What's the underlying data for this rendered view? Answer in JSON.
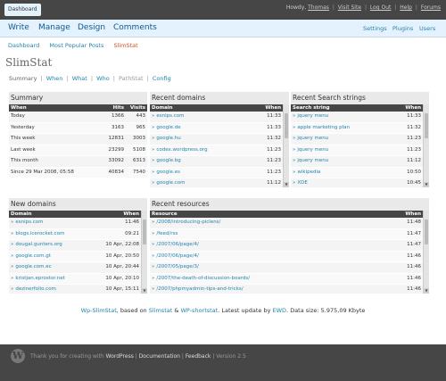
{
  "topbar": {
    "dashboard_label": "Dashboard",
    "howdy": "Howdy,",
    "user": "Thomas",
    "links": [
      "Visit Site",
      "Log Out",
      "Help",
      "Forums"
    ]
  },
  "menu": {
    "main": [
      "Write",
      "Manage",
      "Design",
      "Comments"
    ],
    "right": [
      "Settings",
      "Plugins",
      "Users"
    ]
  },
  "submenu": [
    "Dashboard",
    "Most Popular Posts",
    "SlimStat"
  ],
  "page_title": "SlimStat",
  "tabs": [
    "Summary",
    "When",
    "What",
    "Who",
    "PathStat",
    "Config"
  ],
  "summary": {
    "title": "Summary",
    "headers": [
      "When",
      "Hits",
      "Visits"
    ],
    "rows": [
      [
        "Today",
        "1366",
        "443"
      ],
      [
        "Yesterday",
        "3163",
        "965"
      ],
      [
        "This week",
        "12831",
        "3003"
      ],
      [
        "Last week",
        "23299",
        "5108"
      ],
      [
        "This month",
        "33092",
        "6313"
      ],
      [
        "Since 29 Mar 2008, 05:58",
        "40834",
        "7540"
      ]
    ]
  },
  "recent_domains": {
    "title": "Recent domains",
    "headers": [
      "Domain",
      "When"
    ],
    "rows": [
      [
        "esnips.com",
        "11:33"
      ],
      [
        "google.de",
        "11:33"
      ],
      [
        "google.hu",
        "11:32"
      ],
      [
        "codex.wordpress.org",
        "11:23"
      ],
      [
        "google.bg",
        "11:23"
      ],
      [
        "google.es",
        "11:23"
      ],
      [
        "google.com",
        "11:12"
      ]
    ]
  },
  "recent_search": {
    "title": "Recent Search strings",
    "headers": [
      "Search string",
      "When"
    ],
    "rows": [
      [
        "jquery menu",
        "11:33"
      ],
      [
        "apple marketing plan",
        "11:32"
      ],
      [
        "jquery menu",
        "11:23"
      ],
      [
        "jquery menu",
        "11:23"
      ],
      [
        "jquery menu",
        "11:12"
      ],
      [
        "wikipedia",
        "10:50"
      ],
      [
        "XDE",
        "10:45"
      ]
    ]
  },
  "new_domains": {
    "title": "New domains",
    "headers": [
      "Domain",
      "When"
    ],
    "rows": [
      [
        "esnips.com",
        "11:46"
      ],
      [
        "blogs.icerocket.com",
        "09:21"
      ],
      [
        "dougal.gunters.org",
        "10 Apr, 22:08"
      ],
      [
        "google.com.gt",
        "10 Apr, 20:50"
      ],
      [
        "google.com.ec",
        "10 Apr, 20:44"
      ],
      [
        "kristjan.eprostor.net",
        "10 Apr, 20:10"
      ],
      [
        "dezinerfolio.com",
        "10 Apr, 15:11"
      ]
    ]
  },
  "recent_resources": {
    "title": "Recent resources",
    "headers": [
      "Resource",
      "When"
    ],
    "rows": [
      [
        "/2008/introducing-piclens/",
        "11:48"
      ],
      [
        "/feed/rss",
        "11:47"
      ],
      [
        "/2007/06/page/4/",
        "11:47"
      ],
      [
        "/2007/06/page/4/",
        "11:46"
      ],
      [
        "/2007/05/page/3/",
        "11:46"
      ],
      [
        "/2007/the-death-of-discussion-boards/",
        "11:46"
      ],
      [
        "/2007/phpmyadmin-tips-and-tricks/",
        "11:46"
      ]
    ]
  },
  "footline": {
    "p1": "Wp-SlimStat",
    "p2": ", based on ",
    "p3": "Slimstat",
    "p4": " & ",
    "p5": "WP-shortstat",
    "p6": ". Latest update by ",
    "p7": "EWD",
    "p8": ". Data size: 5.975,09 Kbyte"
  },
  "footer": {
    "logo_letter": "W",
    "thanks": "Thank you for creating with ",
    "wordpress": "WordPress",
    "documentation": "Documentation",
    "feedback": "Feedback",
    "version": "Version 2.5"
  },
  "colors": {
    "topbar": "#464646",
    "menubar": "#e4f2fd",
    "link": "#2583ad",
    "current": "#d54e21",
    "table_header": "#464646"
  }
}
